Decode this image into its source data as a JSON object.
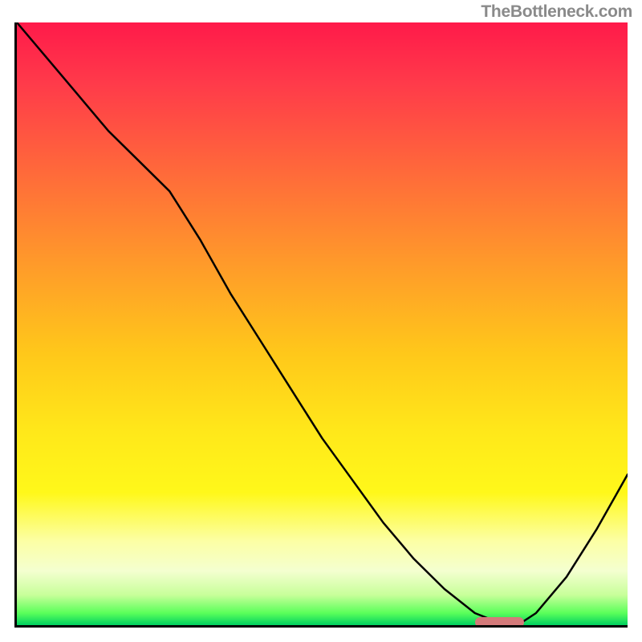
{
  "watermark": "TheBottleneck.com",
  "chart_data": {
    "type": "line",
    "title": "",
    "xlabel": "",
    "ylabel": "",
    "x": [
      0.0,
      0.05,
      0.1,
      0.15,
      0.2,
      0.25,
      0.3,
      0.35,
      0.4,
      0.45,
      0.5,
      0.55,
      0.6,
      0.65,
      0.7,
      0.75,
      0.8,
      0.82,
      0.85,
      0.9,
      0.95,
      1.0
    ],
    "y": [
      1.0,
      0.94,
      0.88,
      0.82,
      0.77,
      0.72,
      0.64,
      0.55,
      0.47,
      0.39,
      0.31,
      0.24,
      0.17,
      0.11,
      0.06,
      0.02,
      0.0,
      0.0,
      0.02,
      0.08,
      0.16,
      0.25
    ],
    "xlim": [
      0,
      1
    ],
    "ylim": [
      0,
      1
    ],
    "marker_segment": {
      "x_start": 0.75,
      "x_end": 0.83,
      "y": 0.0
    },
    "background_gradient": {
      "stops": [
        {
          "pos": 0.0,
          "color": "#ff1a4a"
        },
        {
          "pos": 0.25,
          "color": "#ff6a3a"
        },
        {
          "pos": 0.55,
          "color": "#ffc81a"
        },
        {
          "pos": 0.78,
          "color": "#fff81a"
        },
        {
          "pos": 0.95,
          "color": "#c8ff9a"
        },
        {
          "pos": 1.0,
          "color": "#00d060"
        }
      ]
    }
  }
}
